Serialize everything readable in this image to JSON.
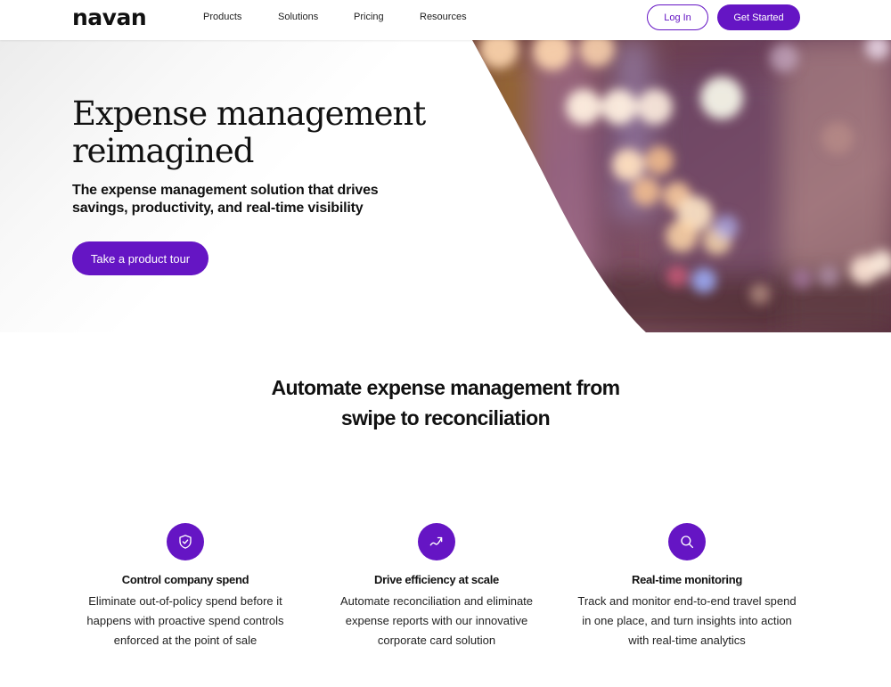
{
  "nav": {
    "logo": "navan",
    "links": [
      "Products",
      "Solutions",
      "Pricing",
      "Resources"
    ],
    "login_label": "Log In",
    "get_started_label": "Get Started"
  },
  "hero": {
    "title_line1": "Expense management",
    "title_line2": "reimagined",
    "subtitle_line1": "The expense management solution that drives",
    "subtitle_line2": "savings, productivity, and real-time visibility",
    "cta_label": "Take a product tour",
    "image": "blurred-city-lights-bokeh"
  },
  "section": {
    "title_line1": "Automate expense management from",
    "title_line2": "swipe to reconciliation"
  },
  "features": [
    {
      "icon": "shield-check-icon",
      "title": "Control company spend",
      "desc": [
        "Eliminate out-of-policy spend before it",
        "happens with proactive spend controls",
        "enforced at the point of sale"
      ]
    },
    {
      "icon": "trending-up-icon",
      "title": "Drive efficiency at scale",
      "desc": [
        "Automate reconciliation and eliminate",
        "expense reports with our innovative",
        "corporate card solution"
      ]
    },
    {
      "icon": "search-icon",
      "title": "Real-time monitoring",
      "desc": [
        "Track and monitor end-to-end travel spend",
        "in one place, and turn insights into action",
        "with real-time analytics"
      ]
    }
  ],
  "colors": {
    "brand": "#6515c4",
    "text": "#111111"
  }
}
